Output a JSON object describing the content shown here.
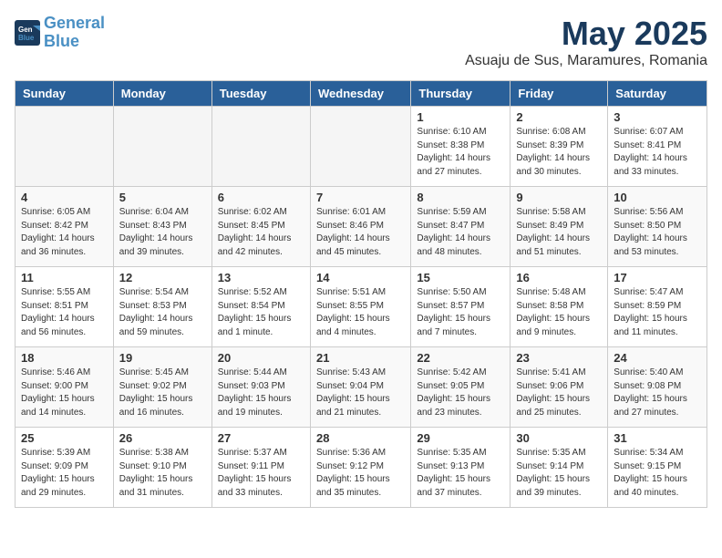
{
  "header": {
    "logo_line1": "General",
    "logo_line2": "Blue",
    "month_year": "May 2025",
    "location": "Asuaju de Sus, Maramures, Romania"
  },
  "weekdays": [
    "Sunday",
    "Monday",
    "Tuesday",
    "Wednesday",
    "Thursday",
    "Friday",
    "Saturday"
  ],
  "weeks": [
    [
      {
        "day": "",
        "info": ""
      },
      {
        "day": "",
        "info": ""
      },
      {
        "day": "",
        "info": ""
      },
      {
        "day": "",
        "info": ""
      },
      {
        "day": "1",
        "info": "Sunrise: 6:10 AM\nSunset: 8:38 PM\nDaylight: 14 hours\nand 27 minutes."
      },
      {
        "day": "2",
        "info": "Sunrise: 6:08 AM\nSunset: 8:39 PM\nDaylight: 14 hours\nand 30 minutes."
      },
      {
        "day": "3",
        "info": "Sunrise: 6:07 AM\nSunset: 8:41 PM\nDaylight: 14 hours\nand 33 minutes."
      }
    ],
    [
      {
        "day": "4",
        "info": "Sunrise: 6:05 AM\nSunset: 8:42 PM\nDaylight: 14 hours\nand 36 minutes."
      },
      {
        "day": "5",
        "info": "Sunrise: 6:04 AM\nSunset: 8:43 PM\nDaylight: 14 hours\nand 39 minutes."
      },
      {
        "day": "6",
        "info": "Sunrise: 6:02 AM\nSunset: 8:45 PM\nDaylight: 14 hours\nand 42 minutes."
      },
      {
        "day": "7",
        "info": "Sunrise: 6:01 AM\nSunset: 8:46 PM\nDaylight: 14 hours\nand 45 minutes."
      },
      {
        "day": "8",
        "info": "Sunrise: 5:59 AM\nSunset: 8:47 PM\nDaylight: 14 hours\nand 48 minutes."
      },
      {
        "day": "9",
        "info": "Sunrise: 5:58 AM\nSunset: 8:49 PM\nDaylight: 14 hours\nand 51 minutes."
      },
      {
        "day": "10",
        "info": "Sunrise: 5:56 AM\nSunset: 8:50 PM\nDaylight: 14 hours\nand 53 minutes."
      }
    ],
    [
      {
        "day": "11",
        "info": "Sunrise: 5:55 AM\nSunset: 8:51 PM\nDaylight: 14 hours\nand 56 minutes."
      },
      {
        "day": "12",
        "info": "Sunrise: 5:54 AM\nSunset: 8:53 PM\nDaylight: 14 hours\nand 59 minutes."
      },
      {
        "day": "13",
        "info": "Sunrise: 5:52 AM\nSunset: 8:54 PM\nDaylight: 15 hours\nand 1 minute."
      },
      {
        "day": "14",
        "info": "Sunrise: 5:51 AM\nSunset: 8:55 PM\nDaylight: 15 hours\nand 4 minutes."
      },
      {
        "day": "15",
        "info": "Sunrise: 5:50 AM\nSunset: 8:57 PM\nDaylight: 15 hours\nand 7 minutes."
      },
      {
        "day": "16",
        "info": "Sunrise: 5:48 AM\nSunset: 8:58 PM\nDaylight: 15 hours\nand 9 minutes."
      },
      {
        "day": "17",
        "info": "Sunrise: 5:47 AM\nSunset: 8:59 PM\nDaylight: 15 hours\nand 11 minutes."
      }
    ],
    [
      {
        "day": "18",
        "info": "Sunrise: 5:46 AM\nSunset: 9:00 PM\nDaylight: 15 hours\nand 14 minutes."
      },
      {
        "day": "19",
        "info": "Sunrise: 5:45 AM\nSunset: 9:02 PM\nDaylight: 15 hours\nand 16 minutes."
      },
      {
        "day": "20",
        "info": "Sunrise: 5:44 AM\nSunset: 9:03 PM\nDaylight: 15 hours\nand 19 minutes."
      },
      {
        "day": "21",
        "info": "Sunrise: 5:43 AM\nSunset: 9:04 PM\nDaylight: 15 hours\nand 21 minutes."
      },
      {
        "day": "22",
        "info": "Sunrise: 5:42 AM\nSunset: 9:05 PM\nDaylight: 15 hours\nand 23 minutes."
      },
      {
        "day": "23",
        "info": "Sunrise: 5:41 AM\nSunset: 9:06 PM\nDaylight: 15 hours\nand 25 minutes."
      },
      {
        "day": "24",
        "info": "Sunrise: 5:40 AM\nSunset: 9:08 PM\nDaylight: 15 hours\nand 27 minutes."
      }
    ],
    [
      {
        "day": "25",
        "info": "Sunrise: 5:39 AM\nSunset: 9:09 PM\nDaylight: 15 hours\nand 29 minutes."
      },
      {
        "day": "26",
        "info": "Sunrise: 5:38 AM\nSunset: 9:10 PM\nDaylight: 15 hours\nand 31 minutes."
      },
      {
        "day": "27",
        "info": "Sunrise: 5:37 AM\nSunset: 9:11 PM\nDaylight: 15 hours\nand 33 minutes."
      },
      {
        "day": "28",
        "info": "Sunrise: 5:36 AM\nSunset: 9:12 PM\nDaylight: 15 hours\nand 35 minutes."
      },
      {
        "day": "29",
        "info": "Sunrise: 5:35 AM\nSunset: 9:13 PM\nDaylight: 15 hours\nand 37 minutes."
      },
      {
        "day": "30",
        "info": "Sunrise: 5:35 AM\nSunset: 9:14 PM\nDaylight: 15 hours\nand 39 minutes."
      },
      {
        "day": "31",
        "info": "Sunrise: 5:34 AM\nSunset: 9:15 PM\nDaylight: 15 hours\nand 40 minutes."
      }
    ]
  ]
}
